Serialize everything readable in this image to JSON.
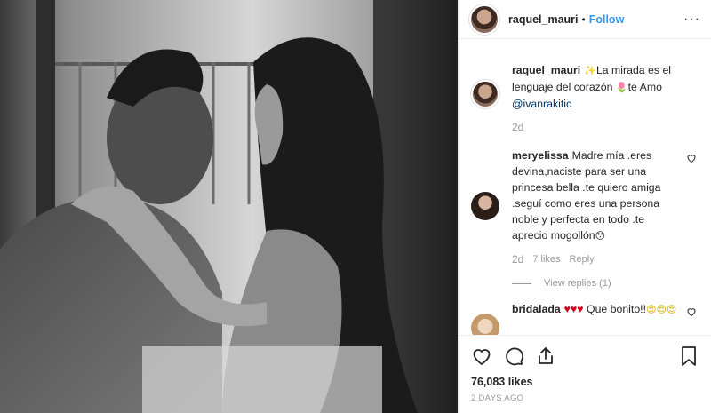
{
  "header": {
    "username": "raquel_mauri",
    "separator": "•",
    "follow_label": "Follow",
    "more_icon": "···"
  },
  "caption": {
    "username": "raquel_mauri",
    "sparkle": "✨",
    "text": "La mirada es el lenguaje del corazón",
    "tulip": "🌷",
    "text2": "te Amo",
    "mention": "@ivanrakitic",
    "when": "2d"
  },
  "comments": [
    {
      "username": "meryelissa",
      "text": "Madre mía .eres devina,naciste para ser una princesa bella .te quiero amiga .seguí como eres una persona noble y perfecta en todo .te aprecio mogollón",
      "emoji": "😯",
      "when": "2d",
      "likes": "7 likes",
      "reply": "Reply",
      "view_replies": "View replies (1)"
    },
    {
      "username": "bridalada",
      "hearts": "♥♥♥",
      "text": "Que bonito!!",
      "emoji": "😍😍😍"
    }
  ],
  "footer": {
    "likes": "76,083 likes",
    "posted": "2 DAYS AGO"
  },
  "colors": {
    "link": "#3897f0",
    "muted": "#999999",
    "border": "#efefef"
  }
}
